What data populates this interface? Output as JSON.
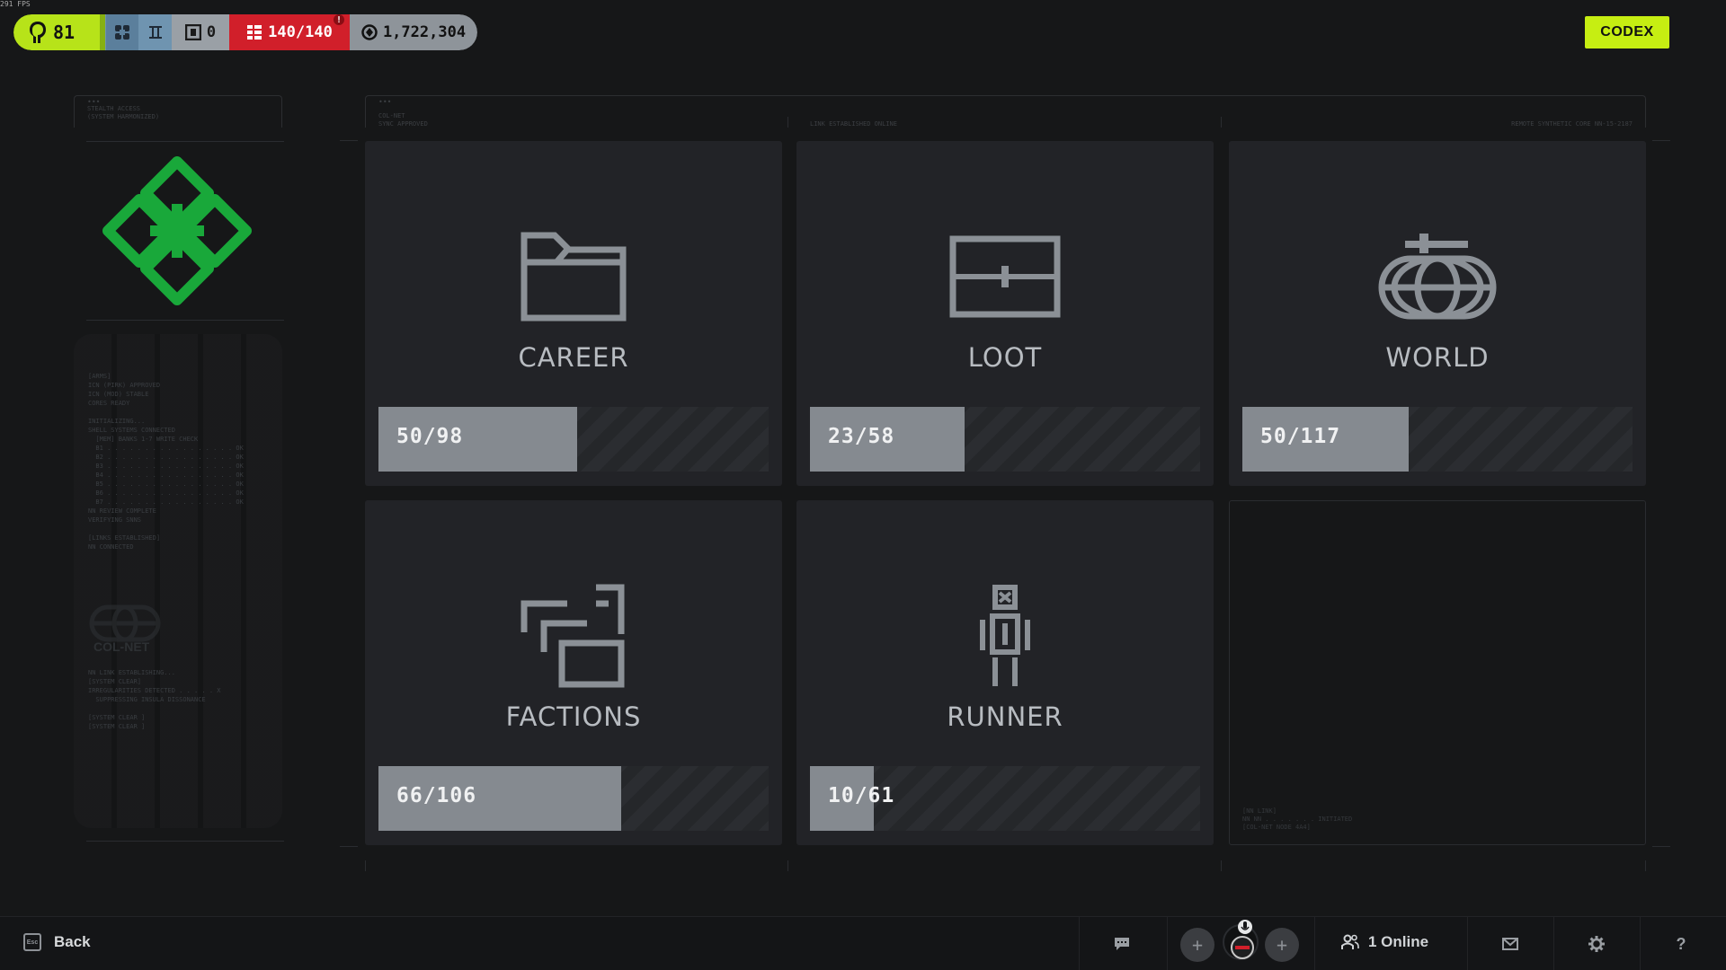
{
  "fps": "291 FPS",
  "hud": {
    "level": "81",
    "stash_count": "0",
    "capacity": "140/140",
    "coins": "1,722,304"
  },
  "codex_label": "CODEX",
  "left_panel": {
    "header_lines": [
      "STEALTH ACCESS",
      "(SYSTEM HARMONIZED)"
    ],
    "boot_text": "[ARMS]\nICN (PIRK) APPROVED\nICN (MOD) STABLE\nCORES READY\n\nINITIALIZING...\nSHELL SYSTEMS CONNECTED\n  [MEM] BANKS 1-7 WRITE CHECK\n  B1 . . . . . . . . . . . . . . . . . OK\n  B2 . . . . . . . . . . . . . . . . . OK\n  B3 . . . . . . . . . . . . . . . . . OK\n  B4 . . . . . . . . . . . . . . . . . OK\n  B5 . . . . . . . . . . . . . . . . . OK\n  B6 . . . . . . . . . . . . . . . . . OK\n  B7 . . . . . . . . . . . . . . . . . OK\nNN REVIEW COMPLETE\nVERIFYING SNNS\n\n[LINKS ESTABLISHED]\nNN CONNECTED",
    "colnet_label": "COL-NET",
    "footer_text": "NN LINK ESTABLISHING...\n[SYSTEM CLEAR]\nIRREGULARITIES DETECTED . . . . . X\n  SUPPRESSING INSULA DISSONANCE\n\n[SYSTEM CLEAR ]\n[SYSTEM CLEAR ]"
  },
  "main_panel": {
    "header_left": [
      "COL-NET",
      "SYNC APPROVED"
    ],
    "header_mid": "LINK ESTABLISHED ONLINE",
    "header_right": "REMOTE SYNTHETIC CORE NN-15-2187"
  },
  "cards": [
    {
      "title": "CAREER",
      "current": 50,
      "total": 98,
      "label": "50/98",
      "icon": "folder-icon"
    },
    {
      "title": "LOOT",
      "current": 23,
      "total": 58,
      "label": "23/58",
      "icon": "crate-icon"
    },
    {
      "title": "WORLD",
      "current": 50,
      "total": 117,
      "label": "50/117",
      "icon": "world-icon"
    },
    {
      "title": "FACTIONS",
      "current": 66,
      "total": 106,
      "label": "66/106",
      "icon": "factions-icon"
    },
    {
      "title": "RUNNER",
      "current": 10,
      "total": 61,
      "label": "10/61",
      "icon": "runner-icon"
    }
  ],
  "empty_card_text": "[NN LINK]\nNN NN . . . . . . . INITIATED\n[COL-NET NODE 4A4]",
  "bottom": {
    "back_label": "Back",
    "esc_label": "Esc",
    "online_label": "1 Online"
  }
}
